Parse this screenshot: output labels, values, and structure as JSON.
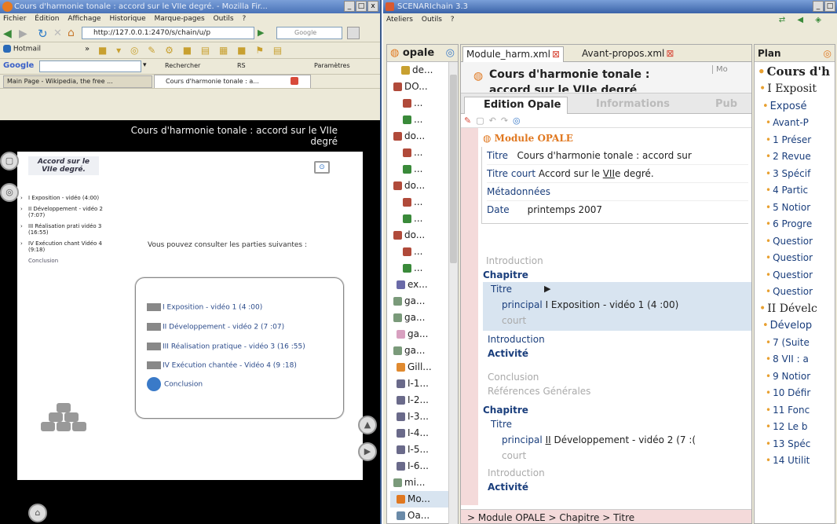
{
  "firefox": {
    "title": "Cours d'harmonie tonale : accord sur le VIIe degré. - Mozilla Fir...",
    "menu": [
      "Fichier",
      "Édition",
      "Affichage",
      "Historique",
      "Marque-pages",
      "Outils",
      "?"
    ],
    "url": "http://127.0.0.1:2470/s/chain/u/p",
    "search_placeholder": "Google",
    "bm_hotmail": "Hotmail",
    "google_label": "Google",
    "google_rechercher": "Rechercher",
    "google_rs": "RS",
    "google_params": "Paramètres",
    "tab1": "Main Page - Wikipedia, the free ...",
    "tab2": "Cours d'harmonie tonale : a..."
  },
  "course": {
    "header": "Cours d'harmonie tonale : accord sur le VIIe degré",
    "subtitle": "Accord sur le VIIe degré.",
    "nav": [
      "I Exposition - vidéo (4:00)",
      "II Développement - vidéo 2 (7:07)",
      "III Réalisation prati vidéo 3 (16:55)",
      "IV Exécution chant Vidéo 4 (9:18)"
    ],
    "nav_conclusion": "Conclusion",
    "intro_text": "Vous pouvez consulter les parties suivantes :",
    "parts": [
      "I Exposition - vidéo 1 (4 :00)",
      "II Développement - vidéo 2 (7 :07)",
      "III Réalisation pratique - vidéo 3 (16 :55)",
      "IV Exécution chantée - Vidéo 4 (9 :18)"
    ],
    "conclusion": "Conclusion"
  },
  "scenari": {
    "title": "SCENARIchain 3.3",
    "menu": [
      "Ateliers",
      "Outils",
      "?"
    ],
    "workshop": "opale",
    "tree": [
      "de...",
      "DO...",
      "...",
      "...",
      "do...",
      "...",
      "...",
      "do...",
      "...",
      "...",
      "do...",
      "...",
      "...",
      "ex...",
      "ga...",
      "ga...",
      "ga...",
      "ga...",
      "Gill...",
      "I-1...",
      "I-2...",
      "I-3...",
      "I-4...",
      "I-5...",
      "I-6...",
      "mi...",
      "Mo...",
      "Oa..."
    ],
    "tabs": [
      "Module_harm.xml",
      "Avant-propos.xml"
    ],
    "doc_title": "Cours d'harmonie tonale :",
    "doc_title2": "accord sur le VIIe degré",
    "doc_title_right": "Mo",
    "subtabs": [
      "Edition Opale",
      "Informations",
      "Pub"
    ],
    "module_label": "Module OPALE",
    "fields": {
      "titre_label": "Titre",
      "titre_val": "Cours d'harmonie tonale : accord sur",
      "titre_court_label": "Titre court",
      "titre_court_val_pre": "Accord sur le ",
      "titre_court_val_u": "VII",
      "titre_court_val_post": "e degré.",
      "meta_label": "Métadonnées",
      "date_label": "Date",
      "date_val": "printemps 2007"
    },
    "introduction": "Introduction",
    "chapitre": "Chapitre",
    "titre": "Titre",
    "principal": "principal",
    "court": "court",
    "chap1_title": "I Exposition - vidéo 1 (4 :00)",
    "activite": "Activité",
    "conclusion": "Conclusion",
    "refs": "Références Générales",
    "chap2_title_pre": "",
    "chap2_title_u": "II",
    "chap2_title_post": " Développement - vidéo 2 (7 :(",
    "breadcrumb": "> Module OPALE > Chapitre > Titre"
  },
  "plan": {
    "header": "Plan",
    "root": "Cours d'h",
    "items": [
      {
        "t": "I Exposit",
        "lvl": 1,
        "type": "sec"
      },
      {
        "t": "Exposé",
        "lvl": 2,
        "type": "sub"
      },
      {
        "t": "Avant-P",
        "lvl": 3,
        "type": "item"
      },
      {
        "t": "1 Préser",
        "lvl": 3,
        "type": "item"
      },
      {
        "t": "2 Revue",
        "lvl": 3,
        "type": "item"
      },
      {
        "t": "3 Spécif",
        "lvl": 3,
        "type": "item"
      },
      {
        "t": "4 Partic",
        "lvl": 3,
        "type": "item"
      },
      {
        "t": "5 Notior",
        "lvl": 3,
        "type": "item"
      },
      {
        "t": "6 Progre",
        "lvl": 3,
        "type": "item"
      },
      {
        "t": "Questior",
        "lvl": 3,
        "type": "item"
      },
      {
        "t": "Questior",
        "lvl": 3,
        "type": "item"
      },
      {
        "t": "Questior",
        "lvl": 3,
        "type": "item"
      },
      {
        "t": "Questior",
        "lvl": 3,
        "type": "item"
      },
      {
        "t": "II Dévelc",
        "lvl": 1,
        "type": "sec"
      },
      {
        "t": "Dévelop",
        "lvl": 2,
        "type": "sub"
      },
      {
        "t": "7 (Suite",
        "lvl": 3,
        "type": "item"
      },
      {
        "t": "8 VII : a",
        "lvl": 3,
        "type": "item"
      },
      {
        "t": "9 Notior",
        "lvl": 3,
        "type": "item"
      },
      {
        "t": "10 Défir",
        "lvl": 3,
        "type": "item"
      },
      {
        "t": "11 Fonc",
        "lvl": 3,
        "type": "item"
      },
      {
        "t": "12 Le b",
        "lvl": 3,
        "type": "item"
      },
      {
        "t": "13 Spéc",
        "lvl": 3,
        "type": "item"
      },
      {
        "t": "14 Utilit",
        "lvl": 3,
        "type": "item"
      }
    ]
  }
}
